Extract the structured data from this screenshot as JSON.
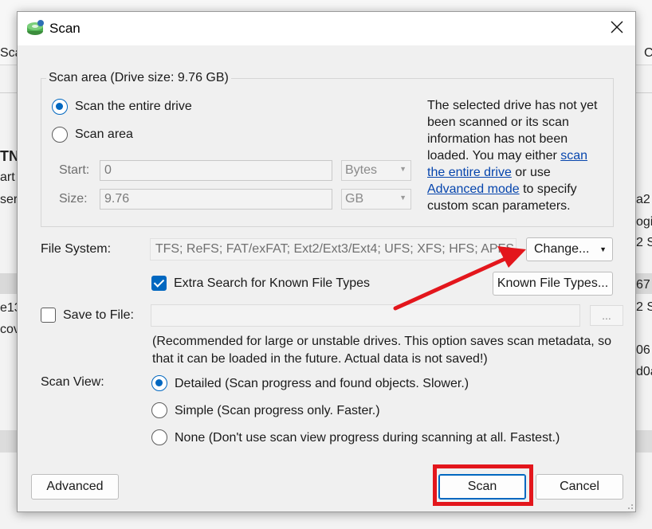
{
  "background": {
    "fragments": [
      "Sca",
      "TN",
      "art",
      "ser",
      "e13",
      "cov",
      "C",
      "a2",
      "ogi",
      "2 S",
      "67",
      "2 S",
      "06",
      "d0a"
    ]
  },
  "dialog": {
    "title": "Scan",
    "icons": {
      "app": "disk-scan-icon",
      "close": "close-icon"
    },
    "scan_area": {
      "group_label": "Scan area (Drive size: 9.76 GB)",
      "option_entire": "Scan the entire drive",
      "option_area": "Scan area",
      "selected": "entire",
      "start_label": "Start:",
      "start_value": "0",
      "start_unit": "Bytes",
      "size_label": "Size:",
      "size_value": "9.76",
      "size_unit": "GB",
      "info_part1": "The selected drive has not yet been scanned or its scan information has not been loaded. You may either ",
      "info_link1": "scan the entire drive",
      "info_part2": " or use ",
      "info_link2": "Advanced mode",
      "info_part3": " to specify custom scan parameters."
    },
    "file_system": {
      "label": "File System:",
      "value": "TFS; ReFS; FAT/exFAT; Ext2/Ext3/Ext4; UFS; XFS; HFS; APFS",
      "change_button": "Change...",
      "extra_search_label": "Extra Search for Known File Types",
      "extra_search_checked": true,
      "known_types_button": "Known File Types..."
    },
    "save_to_file": {
      "label": "Save to File:",
      "checked": false,
      "value": "",
      "browse_label": "...",
      "note": "(Recommended for large or unstable drives. This option saves scan metadata, so that it can be loaded in the future. Actual data is not saved!)"
    },
    "scan_view": {
      "label": "Scan View:",
      "selected": "detailed",
      "options": [
        "Detailed (Scan progress and found objects. Slower.)",
        "Simple (Scan progress only. Faster.)",
        "None (Don't use scan view progress during scanning at all. Fastest.)"
      ]
    },
    "buttons": {
      "advanced": "Advanced",
      "scan": "Scan",
      "cancel": "Cancel"
    }
  },
  "annotation_colors": {
    "highlight": "#e3161c",
    "accent": "#0067c0"
  }
}
